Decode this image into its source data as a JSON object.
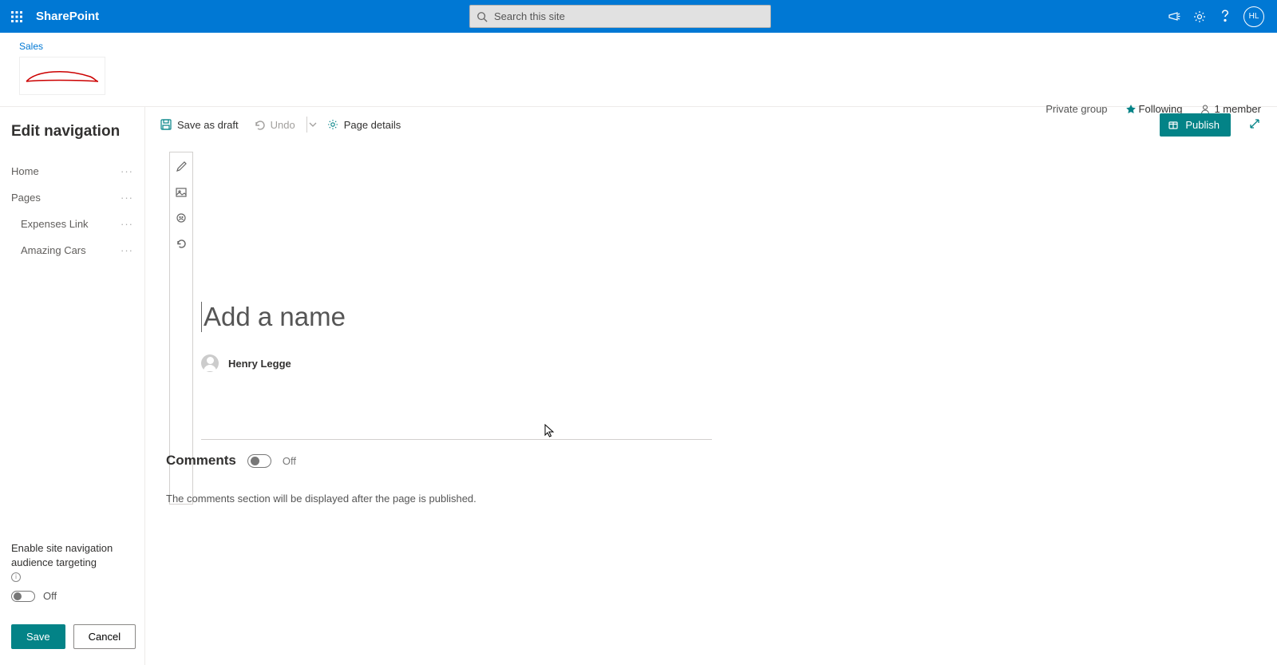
{
  "topbar": {
    "brand": "SharePoint",
    "search_placeholder": "Search this site",
    "avatar_initials": "HL"
  },
  "site": {
    "name": "Sales",
    "privacy": "Private group",
    "following_label": "Following",
    "members_label": "1 member"
  },
  "sidebar": {
    "heading": "Edit navigation",
    "items": [
      {
        "label": "Home",
        "indent": false
      },
      {
        "label": "Pages",
        "indent": false
      },
      {
        "label": "Expenses Link",
        "indent": true
      },
      {
        "label": "Amazing Cars",
        "indent": true
      }
    ],
    "audience_label": "Enable site navigation audience targeting",
    "audience_toggle_state": "Off",
    "save_label": "Save",
    "cancel_label": "Cancel"
  },
  "commands": {
    "save_draft": "Save as draft",
    "undo": "Undo",
    "page_details": "Page details",
    "publish": "Publish"
  },
  "page": {
    "title_placeholder": "Add a name",
    "author_name": "Henry Legge",
    "comments_label": "Comments",
    "comments_toggle_state": "Off",
    "comments_note": "The comments section will be displayed after the page is published."
  }
}
